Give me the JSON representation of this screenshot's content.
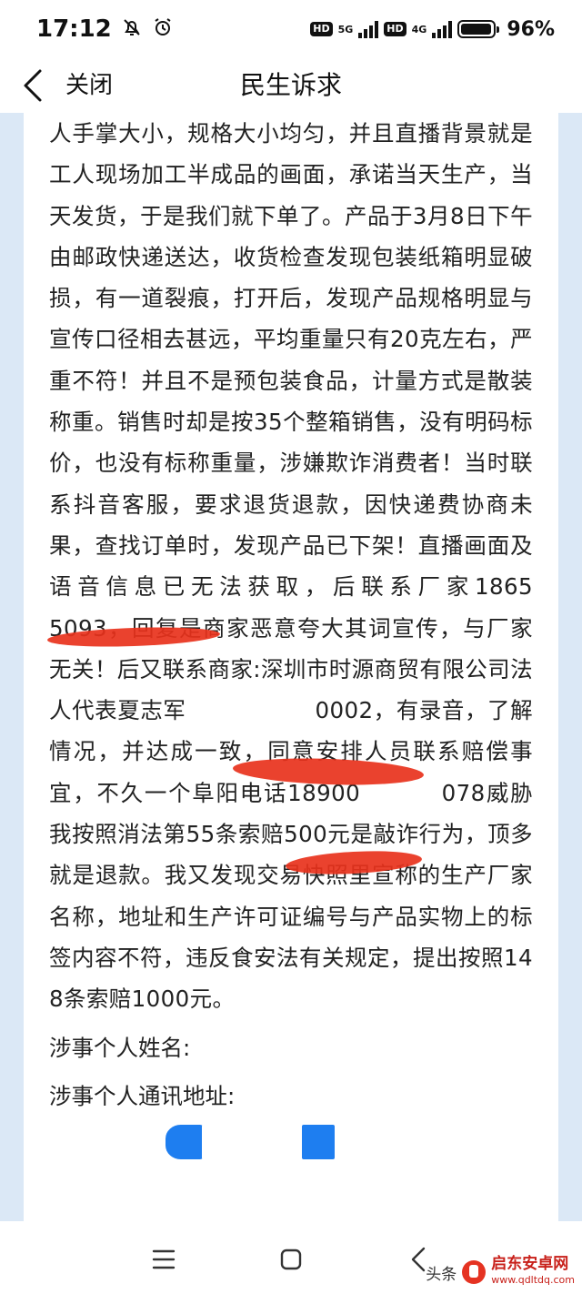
{
  "status_bar": {
    "time": "17:12",
    "net1": "5G",
    "net2": "4G",
    "hd": "HD",
    "battery_percent": 96,
    "battery_text": "96%"
  },
  "nav": {
    "close_label": "关闭",
    "title": "民生诉求"
  },
  "content": {
    "paragraph": "人手掌大小，规格大小均匀，并且直播背景就是工人现场加工半成品的画面，承诺当天生产，当天发货，于是我们就下单了。产品于3月8日下午由邮政快递送达，收货检查发现包装纸箱明显破损，有一道裂痕，打开后，发现产品规格明显与宣传口径相去甚远，平均重量只有20克左右，严重不符！并且不是预包装食品，计量方式是散装称重。销售时却是按35个整箱销售，没有明码标价，也没有标称重量，涉嫌欺诈消费者！当时联系抖音客服，要求退货退款，因快递费协商未果，查找订单时，发现产品已下架！直播画面及语音信息已无法获取，后联系厂家1865　　　 5093，回复是商家恶意夸大其词宣传，与厂家无关！后又联系商家:深圳市时源商贸有限公司法人代表夏志军　　　　 　 0002，有录音，了解情况，并达成一致，同意安排人员联系赔偿事宜，不久一个阜阳电话18900　 　　078威胁我按照消法第55条索赔500元是敲诈行为，顶多就是退款。我又发现交易快照里宣称的生产厂家名称，地址和生产许可证编号与产品实物上的标签内容不符，违反食安法有关规定，提出按照148条索赔1000元。",
    "field1_label": "涉事个人姓名:",
    "field2_label": "涉事个人通讯地址:"
  },
  "watermark": {
    "prefix": "头条",
    "brand": "启东安卓网",
    "url": "www.qdltdq.com"
  },
  "colors": {
    "redaction_red": "#e8321c",
    "redaction_blue": "#1e7ef0",
    "page_bg": "#dbe8f6"
  }
}
